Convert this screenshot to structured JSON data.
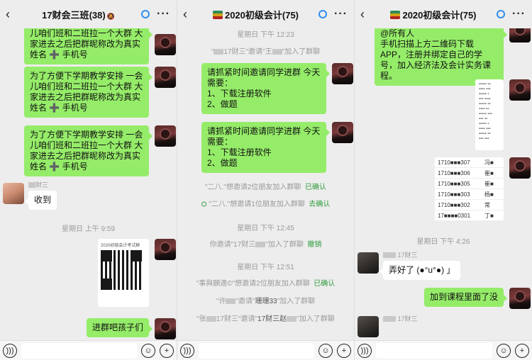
{
  "panels": [
    {
      "title": "17财会三班",
      "count": "(38)",
      "emoji": false,
      "messages": {
        "m1": "儿咱们班和二班拉一个大群 大家进去之后把群昵称改为真实姓名 ➕ 手机号",
        "m2": "为了方便下学期教学安排 一会儿咱们班和二班拉一个大群 大家进去之后把群昵称改为真实姓名 ➕ 手机号",
        "m3": "为了方便下学期教学安排 一会儿咱们班和二班拉一个大群 大家进去之后把群昵称改为真实姓名 ➕ 手机号",
        "sender1": "财三",
        "m4": "收到",
        "time1": "星期日 上午 9:59",
        "qr_title": "2020初级会计考试群",
        "m5": "进群吧孩子们"
      }
    },
    {
      "title": "2020初级会计",
      "count": "(75)",
      "emoji": true,
      "messages": {
        "time1": "星期日 下午 12:23",
        "sys1_a": "\"",
        "sys1_b": "17财三\"邀请\"王",
        "sys1_c": "\"加入了群聊",
        "m1": "请抓紧时间邀请同学进群 今天需要：\n1、下载注册软件\n2、做题",
        "m2": "请抓紧时间邀请同学进群 今天需要：\n1、下载注册软件\n2、做题",
        "sys2": "\"二八.\"想邀请2位朋友加入群聊",
        "sys2_act": "已确认",
        "sys3": "\"二八.\"想邀请1位朋友加入群聊",
        "sys3_act": "去确认",
        "time2": "星期日 下午 12:45",
        "sys4_a": "你邀请\"17财三",
        "sys4_b": "\"加入了群聊",
        "sys4_act": "撤销",
        "time3": "星期日 下午 12:51",
        "sys5": "\"事與願違©\"想邀请2位朋友加入群聊",
        "sys5_act": "已确认",
        "sys6_a": "\"许",
        "sys6_b": "\"邀请\"",
        "sys6_c": "珊珊33",
        "sys6_d": "\"加入了群聊",
        "sys7_a": "\"张",
        "sys7_b": "17财三\"邀请\"",
        "sys7_c": "17财三赵",
        "sys7_d": "\"加入了群聊"
      }
    },
    {
      "title": "2020初级会计",
      "count": "(75)",
      "emoji": true,
      "messages": {
        "m1": "@所有人\n手机扫描上方二维码下载 APP，注册并绑定自己的学号，加入经济法及会计实务课程。",
        "table": [
          [
            "1710■■■307",
            "冯■"
          ],
          [
            "1710■■■306",
            "崔■"
          ],
          [
            "1710■■■305",
            "崔■"
          ],
          [
            "1710■■■303",
            "杨■"
          ],
          [
            "1710■■■302",
            "常"
          ],
          [
            "17■■■■0301",
            "丁■"
          ]
        ],
        "time1": "星期日 下午 4:26",
        "sender1": "17财三",
        "m2": "弄好了 (●°u°●)​ 」",
        "m3": "加到课程里面了没",
        "sender2": "17财三"
      }
    }
  ],
  "icons": {
    "back": "chevron-left-icon",
    "voice": "voice-icon",
    "emoji": "emoji-icon",
    "plus": "plus-icon",
    "more": "more-icon"
  },
  "colors": {
    "bubble_green": "#95ec69",
    "link_green": "#2f9b3c",
    "sync_blue": "#2f8ef0"
  }
}
